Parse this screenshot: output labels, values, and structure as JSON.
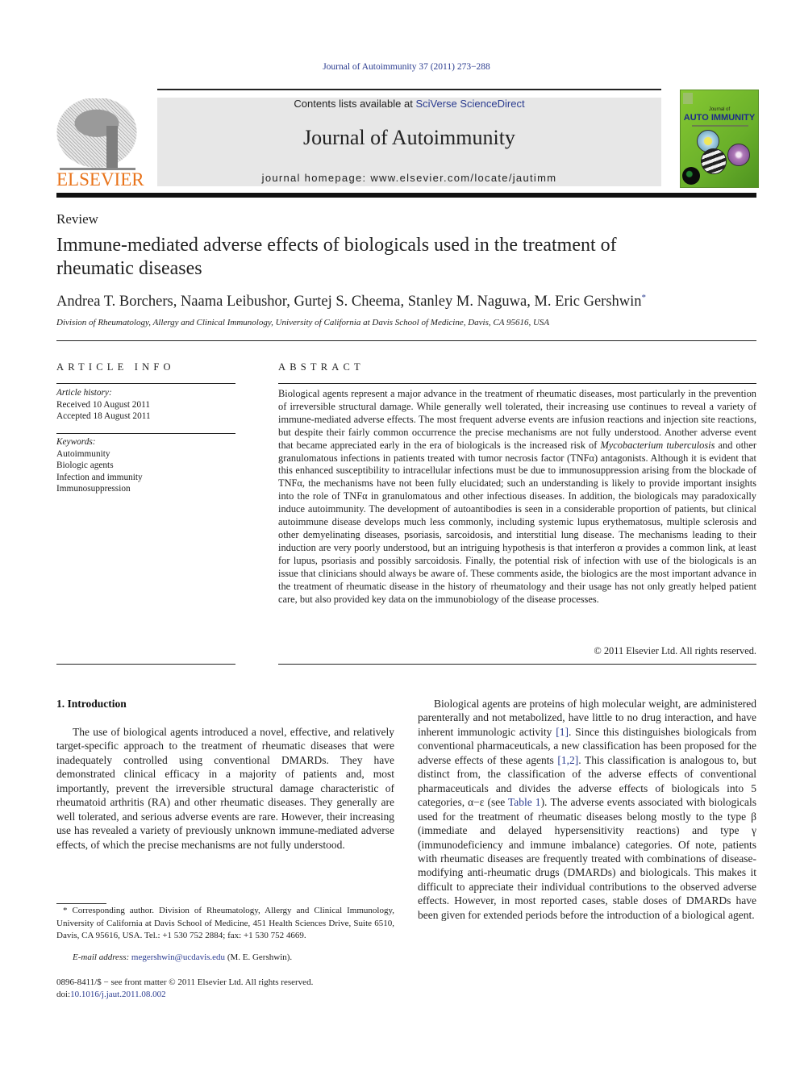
{
  "running_head": "Journal of Autoimmunity 37 (2011) 273−288",
  "publisher": {
    "logo_text": "ELSEVIER",
    "logo_icon": "elsevier-tree-icon"
  },
  "banner": {
    "contents_prefix": "Contents lists available at ",
    "contents_link": "SciVerse ScienceDirect",
    "journal_title": "Journal of Autoimmunity",
    "homepage": "journal homepage: www.elsevier.com/locate/jautimm"
  },
  "cover": {
    "small_text": "Journal of",
    "title": "AUTO IMMUNITY"
  },
  "article": {
    "type": "Review",
    "title": "Immune-mediated adverse effects of biologicals used in the treatment of rheumatic diseases",
    "authors": "Andrea T. Borchers, Naama Leibushor, Gurtej S. Cheema, Stanley M. Naguwa, M. Eric Gershwin",
    "corresponding_mark": "*",
    "affiliation": "Division of Rheumatology, Allergy and Clinical Immunology, University of California at Davis School of Medicine, Davis, CA 95616, USA"
  },
  "article_info": {
    "heading": "ARTICLE INFO",
    "history_label": "Article history:",
    "received": "Received 10 August 2011",
    "accepted": "Accepted 18 August 2011",
    "keywords_label": "Keywords:",
    "keywords": [
      "Autoimmunity",
      "Biologic agents",
      "Infection and immunity",
      "Immunosuppression"
    ]
  },
  "abstract": {
    "heading": "ABSTRACT",
    "part1": "Biological agents represent a major advance in the treatment of rheumatic diseases, most particularly in the prevention of irreversible structural damage. While generally well tolerated, their increasing use continues to reveal a variety of immune-mediated adverse effects. The most frequent adverse events are infusion reactions and injection site reactions, but despite their fairly common occurrence the precise mechanisms are not fully understood. Another adverse event that became appreciated early in the era of biologicals is the increased risk of ",
    "italic": "Mycobacterium tuberculosis",
    "part2": " and other granulomatous infections in patients treated with tumor necrosis factor (TNFα) antagonists. Although it is evident that this enhanced susceptibility to intracellular infections must be due to immunosuppression arising from the blockade of TNFα, the mechanisms have not been fully elucidated; such an understanding is likely to provide important insights into the role of TNFα in granulomatous and other infectious diseases. In addition, the biologicals may paradoxically induce autoimmunity. The development of autoantibodies is seen in a considerable proportion of patients, but clinical autoimmune disease develops much less commonly, including systemic lupus erythematosus, multiple sclerosis and other demyelinating diseases, psoriasis, sarcoidosis, and interstitial lung disease. The mechanisms leading to their induction are very poorly understood, but an intriguing hypothesis is that interferon α provides a common link, at least for lupus, psoriasis and possibly sarcoidosis. Finally, the potential risk of infection with use of the biologicals is an issue that clinicians should always be aware of. These comments aside, the biologics are the most important advance in the treatment of rheumatic disease in the history of rheumatology and their usage has not only greatly helped patient care, but also provided key data on the immunobiology of the disease processes.",
    "copyright": "© 2011 Elsevier Ltd. All rights reserved."
  },
  "introduction": {
    "heading": "1.  Introduction",
    "para1": "The use of biological agents introduced a novel, effective, and relatively target-specific approach to the treatment of rheumatic diseases that were inadequately controlled using conventional DMARDs. They have demonstrated clinical efficacy in a majority of patients and, most importantly, prevent the irreversible structural damage characteristic of rheumatoid arthritis (RA) and other rheumatic diseases. They generally are well tolerated, and serious adverse events are rare. However, their increasing use has revealed a variety of previously unknown immune-mediated adverse effects, of which the precise mechanisms are not fully understood.",
    "para2_a": "Biological agents are proteins of high molecular weight, are administered parenterally and not metabolized, have little to no drug interaction, and have inherent immunologic activity ",
    "ref1": "[1]",
    "para2_b": ". Since this distinguishes biologicals from conventional pharmaceuticals, a new classification has been proposed for the adverse effects of these agents ",
    "ref2": "[1,2]",
    "para2_c": ". This classification is analogous to, but distinct from, the classification of the adverse effects of conventional pharmaceuticals and divides the adverse effects of biologicals into 5 categories, α−ε (see ",
    "table_ref": "Table 1",
    "para2_d": "). The adverse events associated with biologicals used for the treatment of rheumatic diseases belong mostly to the type β (immediate and delayed hypersensitivity reactions) and type γ (immunodeficiency and immune imbalance) categories. Of note, patients with rheumatic diseases are frequently treated with combinations of disease-modifying anti-rheumatic drugs (DMARDs) and biologicals. This makes it difficult to appreciate their individual contributions to the observed adverse effects. However, in most reported cases, stable doses of DMARDs have been given for extended periods before the introduction of a biological agent."
  },
  "footnote": {
    "text": "* Corresponding author. Division of Rheumatology, Allergy and Clinical Immunology, University of California at Davis School of Medicine, 451 Health Sciences Drive, Suite 6510, Davis, CA 95616, USA. Tel.: +1 530 752 2884; fax: +1 530 752 4669.",
    "email_label": "E-mail address: ",
    "email": "megershwin@ucdavis.edu",
    "email_suffix": " (M. E. Gershwin)."
  },
  "front_matter": {
    "issn_line": "0896-8411/$ − see front matter © 2011 Elsevier Ltd. All rights reserved.",
    "doi_label": "doi:",
    "doi": "10.1016/j.jaut.2011.08.002"
  },
  "colors": {
    "link": "#2a3b8f",
    "elsevier_orange": "#e8731a",
    "banner_gray": "#e7e7e7",
    "cover_green": "#78bc2e"
  }
}
